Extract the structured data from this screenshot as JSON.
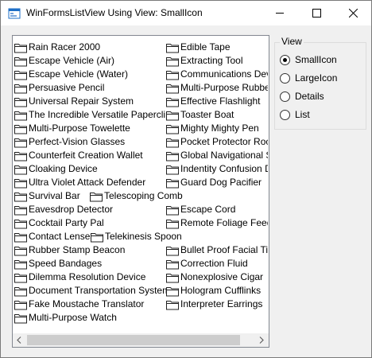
{
  "window": {
    "title": "WinFormsListView Using View: SmallIcon"
  },
  "listview": {
    "column1": [
      "Rain Racer 2000",
      "Escape Vehicle (Air)",
      "Escape Vehicle (Water)",
      "Persuasive Pencil",
      "Universal Repair System",
      "The Incredible Versatile Paperclip",
      "Multi-Purpose Towelette",
      "Perfect-Vision Glasses",
      "Counterfeit Creation Wallet",
      "Cloaking Device",
      "Ultra Violet Attack Defender",
      "Survival Bar",
      "Eavesdrop Detector",
      "Cocktail Party Pal",
      "Contact Lenses",
      "Rubber Stamp Beacon",
      "Speed Bandages",
      "Dilemma Resolution Device",
      "Document Transportation System",
      "Fake Moustache Translator",
      "Multi-Purpose Watch"
    ],
    "column2": [
      "Edible Tape",
      "Extracting Tool",
      "Communications Device",
      "Multi-Purpose Rubber Band",
      "Effective Flashlight",
      "Toaster Boat",
      "Mighty Mighty Pen",
      "Pocket Protector Rocket Pack",
      "Global Navigational System",
      "Indentity Confusion Device",
      "Guard Dog Pacifier",
      "",
      "Escape Cord",
      "Remote Foliage Feeder",
      "",
      "Bullet Proof Facial Tissue",
      "Correction Fluid",
      "Nonexplosive Cigar",
      "Hologram Cufflinks",
      "Interpreter Earrings"
    ],
    "overflow_items": {
      "row12": "Telescoping Comb",
      "row15": "Telekinesis Spoon"
    }
  },
  "view_group": {
    "legend": "View",
    "options": [
      {
        "label": "SmallIcon",
        "checked": true
      },
      {
        "label": "LargeIcon",
        "checked": false
      },
      {
        "label": "Details",
        "checked": false
      },
      {
        "label": "List",
        "checked": false
      }
    ]
  },
  "icons": {
    "app": "form-icon",
    "item": "folder-icon",
    "minimize": "minimize-icon",
    "maximize": "maximize-icon",
    "close": "close-icon"
  }
}
